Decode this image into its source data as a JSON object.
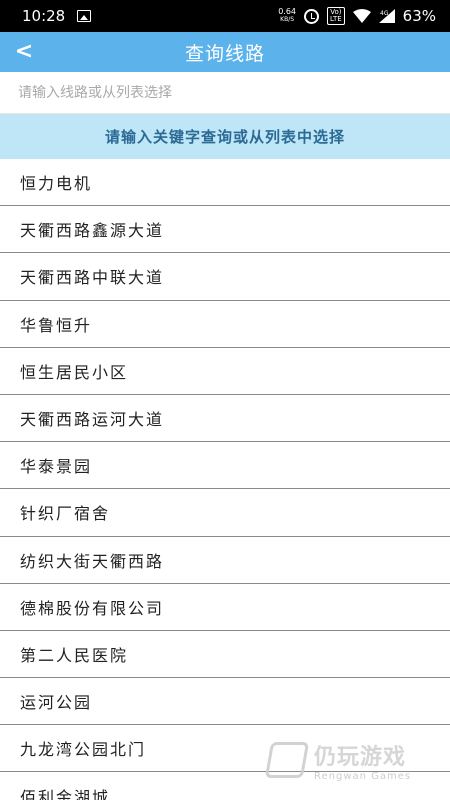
{
  "status_bar": {
    "time": "10:28",
    "net_speed": "0.64",
    "net_unit": "KB/S",
    "volte_top": "Vo)",
    "volte_bottom": "LTE",
    "signal_label": "4G",
    "battery": "63%"
  },
  "app_bar": {
    "back_glyph": "<",
    "title": "查询线路"
  },
  "search": {
    "placeholder": "请输入线路或从列表选择",
    "value": ""
  },
  "hint": "请输入关键字查询或从列表中选择",
  "routes": [
    "恒力电机",
    "天衢西路鑫源大道",
    "天衢西路中联大道",
    "华鲁恒升",
    "恒生居民小区",
    "天衢西路运河大道",
    "华泰景园",
    "针织厂宿舍",
    "纺织大街天衢西路",
    "德棉股份有限公司",
    "第二人民医院",
    "运河公园",
    "九龙湾公园北门",
    "佰利金湖城"
  ],
  "watermark": {
    "cn": "仍玩游戏",
    "en": "Rengwan Games"
  }
}
